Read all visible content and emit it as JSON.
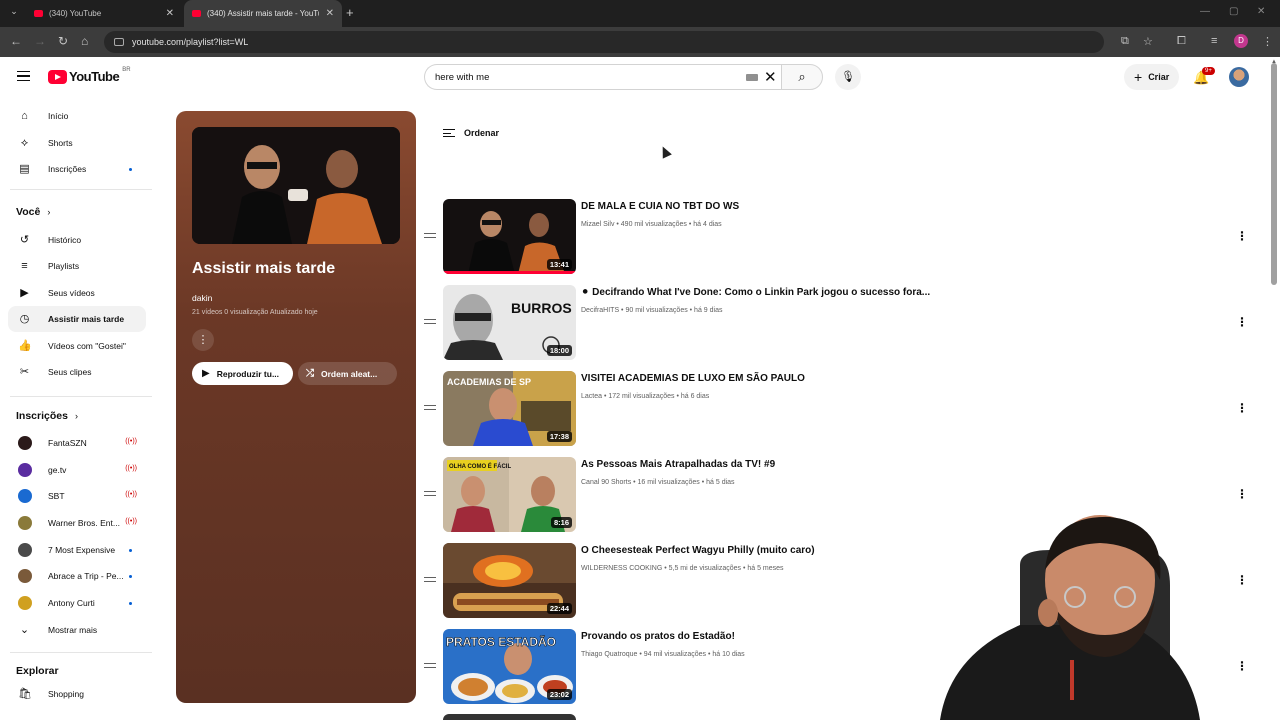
{
  "browser": {
    "tabs": [
      {
        "title": "(340) YouTube",
        "active": false
      },
      {
        "title": "(340) Assistir mais tarde - YouTu",
        "active": true
      }
    ],
    "url": "youtube.com/playlist?list=WL",
    "profile_initial": "D"
  },
  "header": {
    "logo_text": "YouTube",
    "region": "BR",
    "search_value": "here with me",
    "create_label": "Criar",
    "notifications_badge": "9+"
  },
  "sidebar": {
    "main": [
      {
        "label": "Início",
        "icon": "home-icon"
      },
      {
        "label": "Shorts",
        "icon": "shorts-icon"
      },
      {
        "label": "Inscrições",
        "icon": "subscriptions-icon"
      }
    ],
    "you_header": "Você",
    "you": [
      {
        "label": "Histórico",
        "icon": "history-icon"
      },
      {
        "label": "Playlists",
        "icon": "playlists-icon"
      },
      {
        "label": "Seus vídeos",
        "icon": "your-videos-icon"
      },
      {
        "label": "Assistir mais tarde",
        "icon": "watch-later-icon"
      },
      {
        "label": "Vídeos com \"Gostei\"",
        "icon": "liked-icon"
      },
      {
        "label": "Seus clipes",
        "icon": "clips-icon"
      }
    ],
    "subs_header": "Inscrições",
    "subs": [
      {
        "label": "FantaSZN",
        "status": "live",
        "color": "#2b1a1a"
      },
      {
        "label": "ge.tv",
        "status": "live",
        "color": "#5a2ca0"
      },
      {
        "label": "SBT",
        "status": "live",
        "color": "#1a6ad1"
      },
      {
        "label": "Warner Bros. Ent...",
        "status": "live",
        "color": "#8a7a3a"
      },
      {
        "label": "7 Most Expensive",
        "status": "new",
        "color": "#4a4a4a"
      },
      {
        "label": "Abrace a Trip - Pe...",
        "status": "new",
        "color": "#7a5a3a"
      },
      {
        "label": "Antony Curti",
        "status": "new",
        "color": "#d0a020"
      }
    ],
    "show_more": "Mostrar mais",
    "explore_header": "Explorar",
    "explore": [
      {
        "label": "Shopping",
        "icon": "shopping-icon"
      }
    ]
  },
  "playlist": {
    "title": "Assistir mais tarde",
    "owner": "dakin",
    "meta": "21 vídeos  0 visualização  Atualizado hoje",
    "play_all": "Reproduzir tu...",
    "shuffle": "Ordem aleat..."
  },
  "sort_label": "Ordenar",
  "videos": [
    {
      "title": "DE MALA E CUIA NO TBT DO WS",
      "meta": "Mizael Silv • 490 mil visualizações • há 4 dias",
      "duration": "13:41",
      "progress": 1.0
    },
    {
      "title": "⚫ Decifrando What I've Done: Como o Linkin Park jogou o sucesso fora...",
      "meta": "DecifraHITS • 90 mil visualizações • há 9 dias",
      "duration": "18:00",
      "progress": 0.0
    },
    {
      "title": "VISITEI ACADEMIAS DE LUXO EM SÃO PAULO",
      "meta": "Lactea • 172 mil visualizações • há 6 dias",
      "duration": "17:38",
      "progress": 0.0
    },
    {
      "title": "As Pessoas Mais Atrapalhadas da TV! #9",
      "meta": "Canal 90 Shorts • 16 mil visualizações • há 5 dias",
      "duration": "8:16",
      "progress": 0.0
    },
    {
      "title": "O Cheesesteak Perfect Wagyu Philly (muito caro)",
      "meta": "WILDERNESS COOKING • 5,5 mi de visualizações • há 5 meses",
      "duration": "22:44",
      "progress": 0.0
    },
    {
      "title": "Provando os pratos do Estadão!",
      "meta": "Thiago Quatroque • 94 mil visualizações • há 10 dias",
      "duration": "23:02",
      "progress": 0.0
    }
  ],
  "thumbnail_text": {
    "v2": "BURROS ou GÊNIOS?",
    "v3": "ACADEMIAS DE SP",
    "v4": "OLHA COMO É FÁCIL",
    "v6": "PRATOS ESTADÃO"
  }
}
